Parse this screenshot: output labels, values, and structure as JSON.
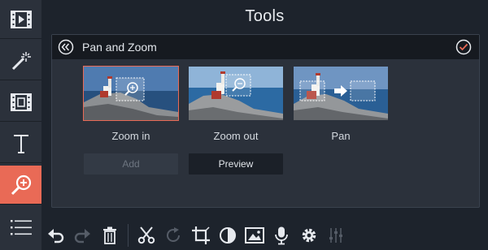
{
  "header": {
    "title": "Tools"
  },
  "panel": {
    "title": "Pan and Zoom",
    "effects": [
      {
        "label": "Zoom in"
      },
      {
        "label": "Zoom out"
      },
      {
        "label": "Pan"
      }
    ],
    "add_label": "Add",
    "preview_label": "Preview"
  },
  "sidebar": {
    "items": [
      {
        "icon": "film-icon"
      },
      {
        "icon": "magic-wand-icon"
      },
      {
        "icon": "clip-icon"
      },
      {
        "icon": "text-icon"
      },
      {
        "icon": "zoom-icon",
        "active": true
      },
      {
        "icon": "menu-icon"
      }
    ]
  },
  "toolbar": {
    "items": [
      "undo-icon",
      "redo-icon",
      "trash-icon",
      "scissors-icon",
      "rotate-icon",
      "crop-icon",
      "contrast-icon",
      "image-icon",
      "microphone-icon",
      "gear-icon",
      "equalizer-icon"
    ]
  },
  "colors": {
    "accent": "#e96a56",
    "background": "#1d232c",
    "panel": "#2b313b"
  }
}
